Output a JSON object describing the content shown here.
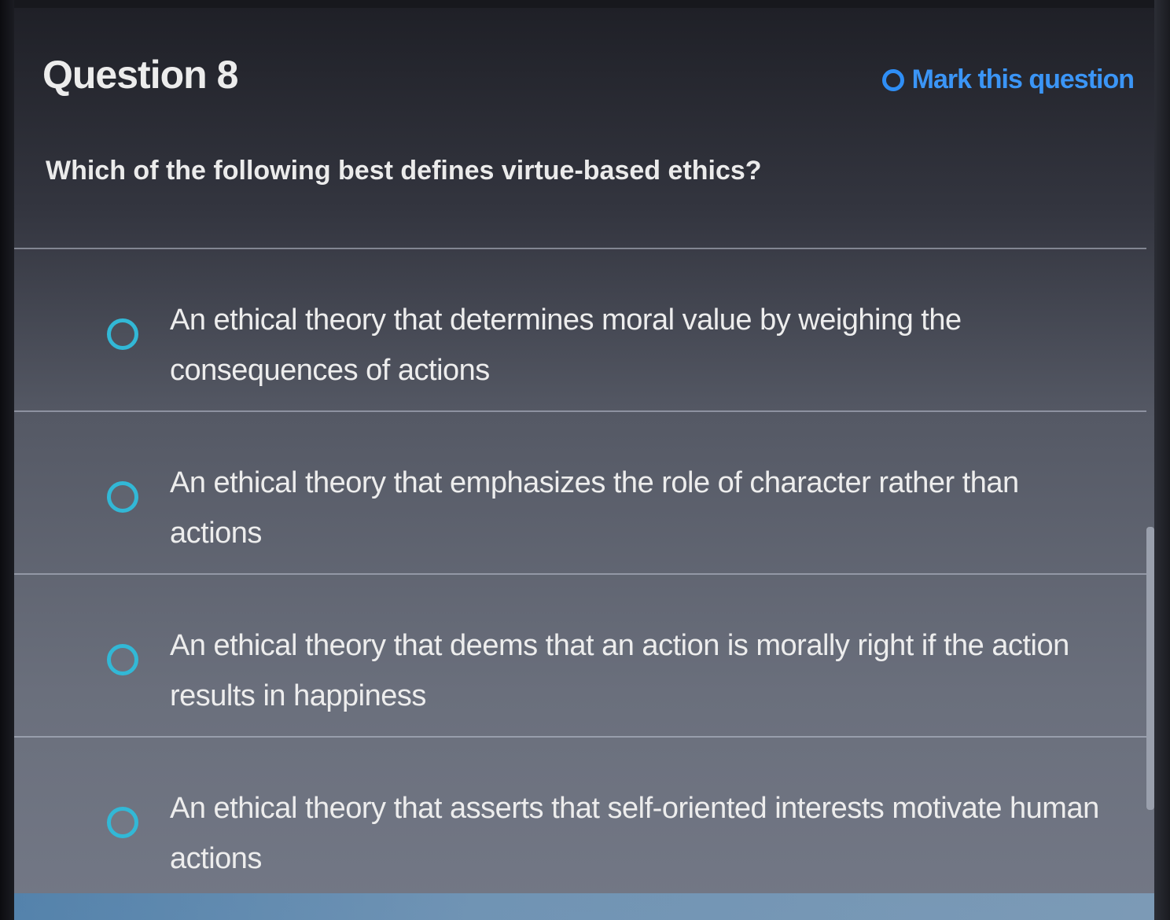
{
  "header": {
    "title": "Question 8",
    "mark_label": "Mark this question"
  },
  "question": {
    "prompt": "Which of the following best defines virtue-based ethics?"
  },
  "options": [
    {
      "text": "An ethical theory that determines moral value by weighing the consequences of actions"
    },
    {
      "text": "An ethical theory that emphasizes the role of character rather than actions"
    },
    {
      "text": "An ethical theory that deems that an action is morally right if the action results in happiness"
    },
    {
      "text": "An ethical theory that asserts that self-oriented interests motivate human actions"
    }
  ],
  "colors": {
    "accent_blue": "#3b95f6",
    "radio_teal": "#32b8d6"
  }
}
